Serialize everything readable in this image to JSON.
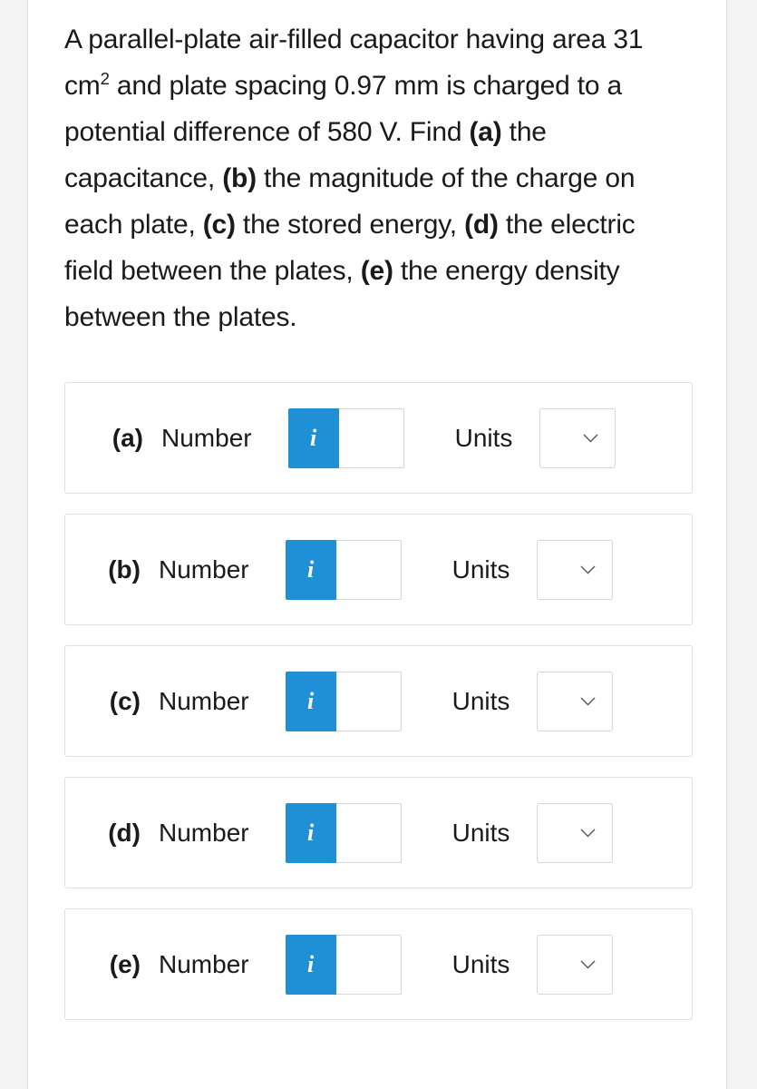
{
  "question": {
    "text_parts": [
      {
        "t": "A parallel-plate air-filled capacitor having area 31 cm",
        "b": false
      },
      {
        "t": "2",
        "sup": true
      },
      {
        "t": " and plate spacing 0.97 mm is charged to a potential difference of 580 V. Find ",
        "b": false
      },
      {
        "t": "(a)",
        "b": true
      },
      {
        "t": " the capacitance, ",
        "b": false
      },
      {
        "t": "(b)",
        "b": true
      },
      {
        "t": " the magnitude of the charge on each plate, ",
        "b": false
      },
      {
        "t": "(c)",
        "b": true
      },
      {
        "t": " the stored energy, ",
        "b": false
      },
      {
        "t": "(d)",
        "b": true
      },
      {
        "t": " the electric field between the plates, ",
        "b": false
      },
      {
        "t": "(e)",
        "b": true
      },
      {
        "t": " the energy density between the plates.",
        "b": false
      }
    ],
    "area_value": "31 cm",
    "spacing_value": "0.97 mm",
    "voltage_value": "580 V"
  },
  "answers": [
    {
      "part": "(a)",
      "number_label": "Number",
      "info_icon": "info-icon",
      "info_glyph": "i",
      "value": "",
      "placeholder": "",
      "units_label": "Units",
      "units_selected": "",
      "chevron_icon": "chevron-down-icon"
    },
    {
      "part": "(b)",
      "number_label": "Number",
      "info_icon": "info-icon",
      "info_glyph": "i",
      "value": "",
      "placeholder": "",
      "units_label": "Units",
      "units_selected": "",
      "chevron_icon": "chevron-down-icon"
    },
    {
      "part": "(c)",
      "number_label": "Number",
      "info_icon": "info-icon",
      "info_glyph": "i",
      "value": "",
      "placeholder": "",
      "units_label": "Units",
      "units_selected": "",
      "chevron_icon": "chevron-down-icon"
    },
    {
      "part": "(d)",
      "number_label": "Number",
      "info_icon": "info-icon",
      "info_glyph": "i",
      "value": "",
      "placeholder": "",
      "units_label": "Units",
      "units_selected": "",
      "chevron_icon": "chevron-down-icon"
    },
    {
      "part": "(e)",
      "number_label": "Number",
      "info_icon": "info-icon",
      "info_glyph": "i",
      "value": "",
      "placeholder": "",
      "units_label": "Units",
      "units_selected": "",
      "chevron_icon": "chevron-down-icon"
    }
  ],
  "colors": {
    "info_badge": "#1f8fd6",
    "border": "#e0e0e0",
    "text": "#1a1a1a",
    "page_edge": "#f3f3f3"
  }
}
